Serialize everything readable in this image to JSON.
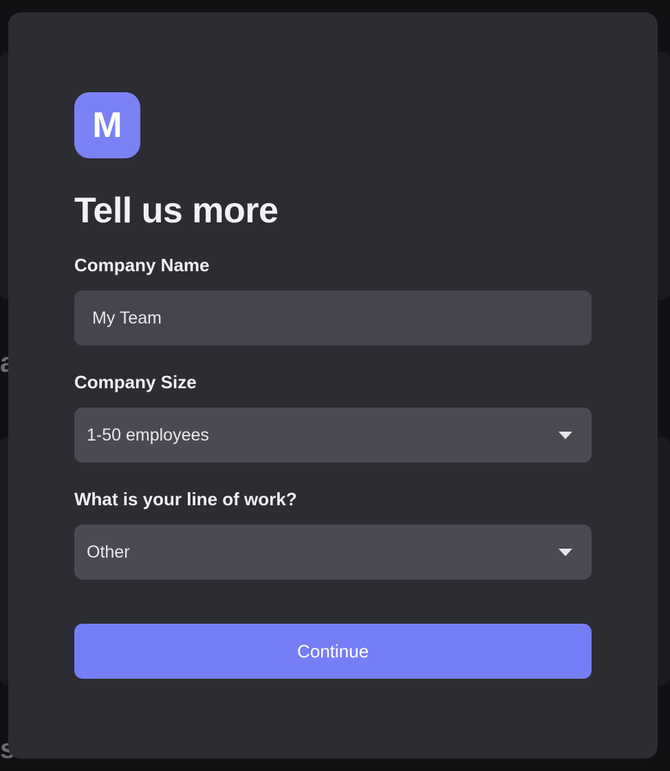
{
  "modal": {
    "logo_letter": "M",
    "title": "Tell us more",
    "company_name": {
      "label": "Company Name",
      "value": "My Team"
    },
    "company_size": {
      "label": "Company Size",
      "selected": "1-50 employees"
    },
    "line_of_work": {
      "label": "What is your line of work?",
      "selected": "Other"
    },
    "continue_label": "Continue"
  },
  "colors": {
    "accent": "#767ef5",
    "modal_bg": "#2c2c33",
    "field_bg": "#45454d"
  },
  "icons": {
    "dropdown": "caret-down-icon"
  }
}
